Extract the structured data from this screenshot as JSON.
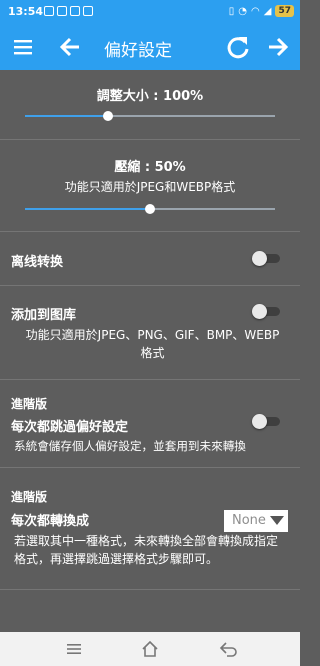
{
  "status_bar": {
    "time": "13:54",
    "battery": "57"
  },
  "app_bar": {
    "title": "偏好設定",
    "icons": [
      "menu-icon",
      "back-arrow-icon",
      "refresh-icon",
      "forward-arrow-icon"
    ]
  },
  "resize": {
    "label": "調整大小 : 100%",
    "value_fraction": 0.33
  },
  "compress": {
    "label": "壓縮 : 50%",
    "note": "功能只適用於JPEG和WEBP格式",
    "value_fraction": 0.5
  },
  "offline": {
    "label": "离线转换",
    "enabled": false
  },
  "add_to_gallery": {
    "label": "添加到图库",
    "note": "功能只適用於JPEG、PNG、GIF、BMP、WEBP格式",
    "enabled": false
  },
  "skip_preferences": {
    "tag": "進階版",
    "label": "每次都跳過偏好設定",
    "note": "系統會儲存個人偏好設定，並套用到未來轉換",
    "enabled": false
  },
  "convert_every_time": {
    "tag": "進階版",
    "label": "每次都轉換成",
    "selected": "None",
    "note": "若選取其中一種格式，未來轉換全部會轉換成指定格式，再選擇跳過選擇格式步驟即可。"
  },
  "colors": {
    "accent": "#2c9ff0",
    "background": "#5d5d5d"
  }
}
